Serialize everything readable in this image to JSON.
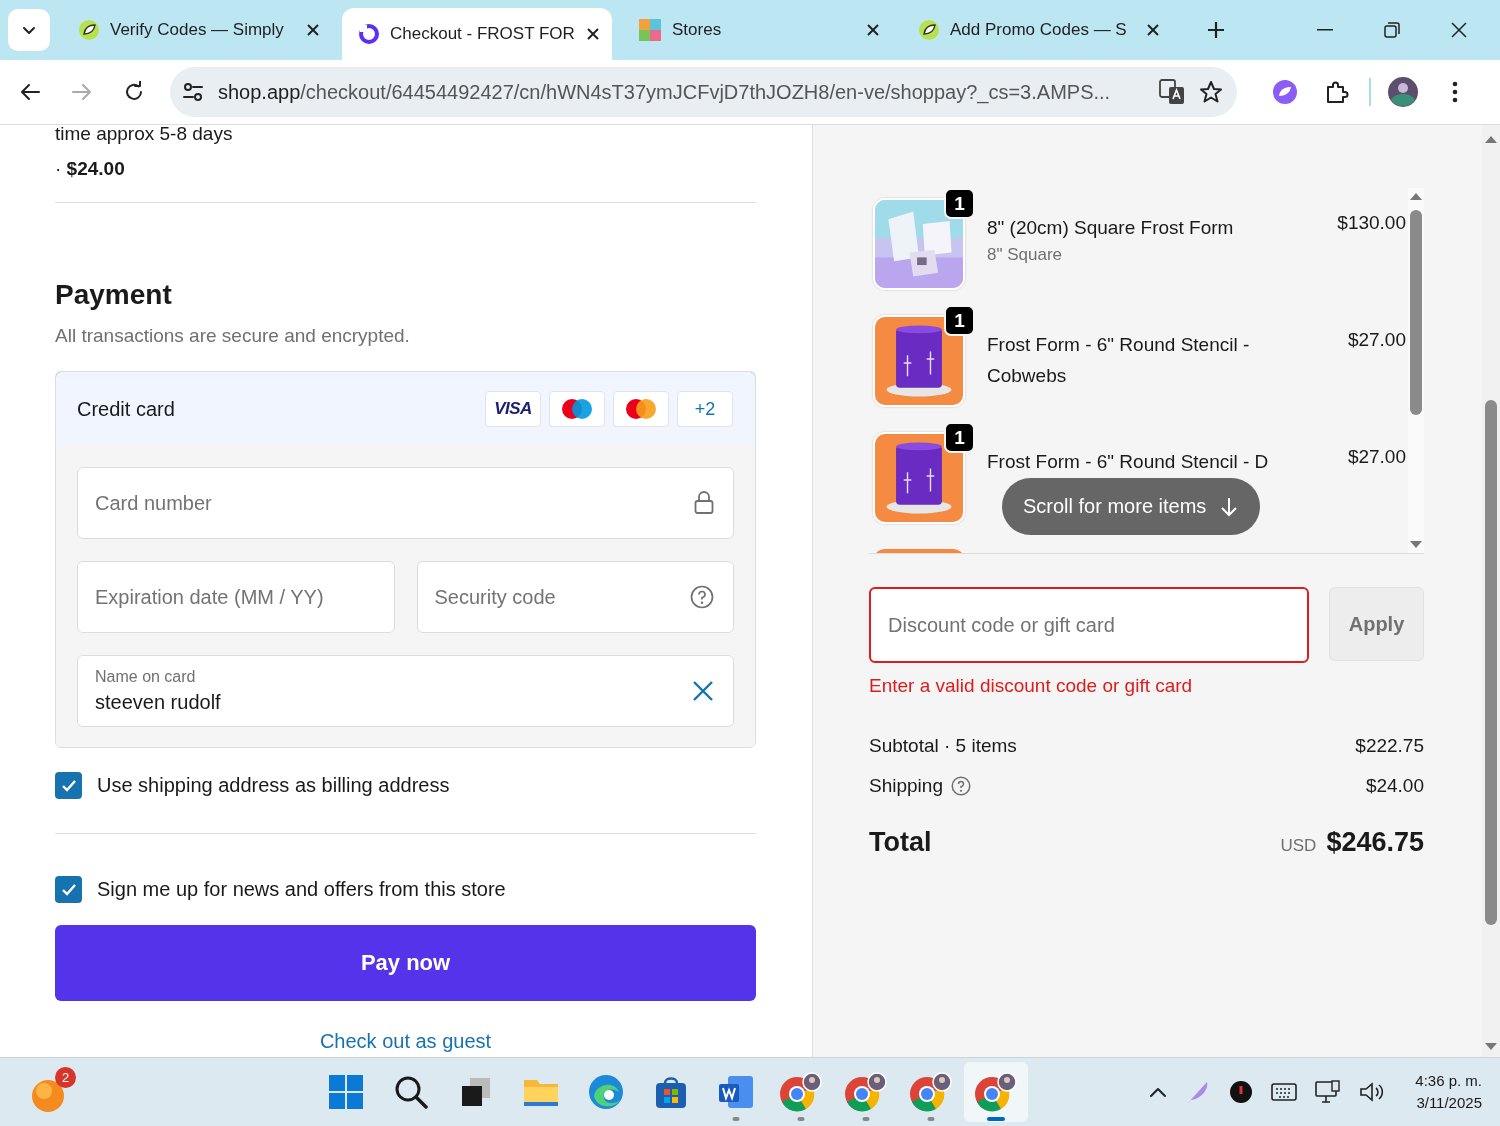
{
  "browser": {
    "tabs": [
      {
        "title": "Verify Codes — Simply",
        "favicon": {
          "kind": "leaf"
        },
        "selected": false
      },
      {
        "title": "Checkout - FROST FOR",
        "favicon": {
          "kind": "shop"
        },
        "selected": true
      },
      {
        "title": "Stores",
        "favicon": {
          "kind": "puzzle"
        },
        "selected": false
      },
      {
        "title": "Add Promo Codes — S",
        "favicon": {
          "kind": "leaf"
        },
        "selected": false
      }
    ],
    "address": {
      "host": "shop.app",
      "path": "/checkout/64454492427/cn/hWN4sT37ymJCFvjD7thJOZH8/en-ve/shoppay?_cs=3.AMPS..."
    }
  },
  "shipping": {
    "note": "time approx 5-8 days",
    "price": "· **$24.00**"
  },
  "payment": {
    "title": "Payment",
    "subtitle": "All transactions are secure and encrypted.",
    "method": {
      "label": "Credit card",
      "selected": true,
      "brands": [
        {
          "kind": "visa",
          "label": "VISA"
        },
        {
          "kind": "maestro"
        },
        {
          "kind": "mastercard"
        },
        {
          "kind": "more",
          "label": "+2"
        }
      ]
    },
    "card_number": {
      "placeholder": "Card number"
    },
    "expiration": {
      "placeholder": "Expiration date (MM / YY)"
    },
    "security_code": {
      "placeholder": "Security code"
    },
    "name_on_card": {
      "label": "Name on card",
      "value": "steeven rudolf"
    }
  },
  "options": [
    {
      "label": "Use shipping address as billing address",
      "checked": true
    },
    {
      "label": "Sign me up for news and offers from this store",
      "checked": true
    }
  ],
  "pay_button": "Pay now",
  "guest_link": "Check out as guest",
  "order": {
    "items": [
      {
        "title": "8\" (20cm) Square Frost Form",
        "variant": "8\" Square",
        "price": "$130.00",
        "quantity": "1"
      },
      {
        "title": "Frost Form - 6\" Round Stencil - Cobwebs",
        "price": "$27.00",
        "quantity": "1"
      },
      {
        "title": "Frost Form - 6\" Round Stencil - D",
        "price": "$27.00",
        "quantity": "1"
      }
    ],
    "scroll_hint": "Scroll for more items",
    "discount": {
      "placeholder": "Discount code or gift card",
      "invalid": true,
      "error": "Enter a valid discount code or gift card"
    },
    "apply_button": "Apply",
    "summary": [
      {
        "label": "Subtotal · 5 items",
        "value": "$222.75",
        "help": false
      },
      {
        "label": "Shipping",
        "value": "$24.00",
        "help": true
      }
    ],
    "total": {
      "label": "Total",
      "currency": "USD",
      "value": "$246.75"
    }
  },
  "taskbar": {
    "widget_badge": "2",
    "apps": [
      {
        "kind": "start",
        "running": false,
        "active": false
      },
      {
        "kind": "search",
        "running": false,
        "active": false
      },
      {
        "kind": "taskview",
        "running": false,
        "active": false
      },
      {
        "kind": "files",
        "running": false,
        "active": false
      },
      {
        "kind": "edge",
        "running": false,
        "active": false
      },
      {
        "kind": "store",
        "running": false,
        "active": false
      },
      {
        "kind": "word",
        "running": true,
        "active": false
      },
      {
        "kind": "chrome",
        "running": true,
        "active": false
      },
      {
        "kind": "chrome",
        "running": true,
        "active": false
      },
      {
        "kind": "chrome",
        "running": true,
        "active": false
      },
      {
        "kind": "chrome",
        "running": true,
        "active": true
      }
    ],
    "clock": {
      "time": "4:36 p. m.",
      "date": "3/11/2025"
    }
  }
}
